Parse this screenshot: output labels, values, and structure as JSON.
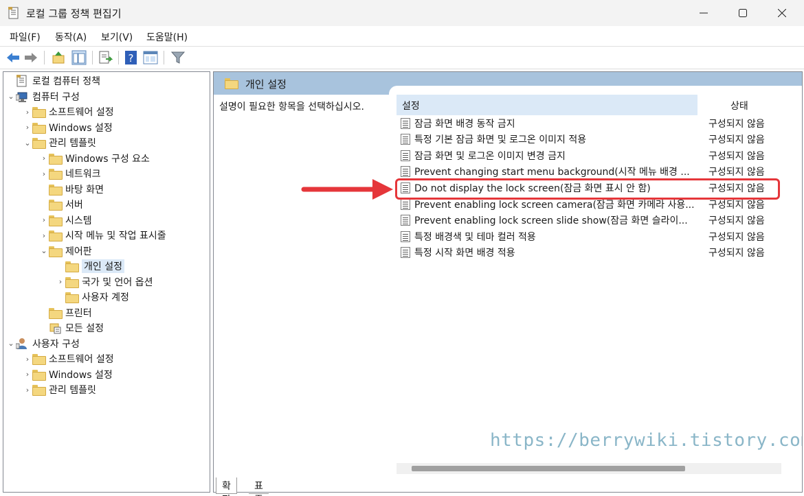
{
  "window": {
    "title": "로컬 그룹 정책 편집기",
    "minimize": "—",
    "maximize": "☐",
    "close": "✕"
  },
  "menu": [
    "파일(F)",
    "동작(A)",
    "보기(V)",
    "도움말(H)"
  ],
  "toolbar": {
    "icons": [
      "back-icon",
      "forward-icon",
      "up-folder-icon",
      "show-hide-tree-icon",
      "export-list-icon",
      "help-icon",
      "properties-icon",
      "filter-icon"
    ]
  },
  "tree": [
    {
      "label": "로컬 컴퓨터 정책",
      "level": 0,
      "chevron": "",
      "icon": "policy-doc-icon"
    },
    {
      "label": "컴퓨터 구성",
      "level": 0,
      "chevron": "⌄",
      "icon": "computer-icon"
    },
    {
      "label": "소프트웨어 설정",
      "level": 1,
      "chevron": "›",
      "icon": "folder-icon"
    },
    {
      "label": "Windows 설정",
      "level": 1,
      "chevron": "›",
      "icon": "folder-icon"
    },
    {
      "label": "관리 템플릿",
      "level": 1,
      "chevron": "⌄",
      "icon": "folder-icon"
    },
    {
      "label": "Windows 구성 요소",
      "level": 2,
      "chevron": "›",
      "icon": "folder-icon"
    },
    {
      "label": "네트워크",
      "level": 2,
      "chevron": "›",
      "icon": "folder-icon"
    },
    {
      "label": "바탕 화면",
      "level": 2,
      "chevron": "",
      "icon": "folder-icon"
    },
    {
      "label": "서버",
      "level": 2,
      "chevron": "",
      "icon": "folder-icon"
    },
    {
      "label": "시스템",
      "level": 2,
      "chevron": "›",
      "icon": "folder-icon"
    },
    {
      "label": "시작 메뉴 및 작업 표시줄",
      "level": 2,
      "chevron": "›",
      "icon": "folder-icon"
    },
    {
      "label": "제어판",
      "level": 2,
      "chevron": "⌄",
      "icon": "folder-icon"
    },
    {
      "label": "개인 설정",
      "level": 3,
      "chevron": "",
      "icon": "folder-open-icon",
      "selected": true
    },
    {
      "label": "국가 및 언어 옵션",
      "level": 3,
      "chevron": "›",
      "icon": "folder-icon"
    },
    {
      "label": "사용자 계정",
      "level": 3,
      "chevron": "",
      "icon": "folder-icon"
    },
    {
      "label": "프린터",
      "level": 2,
      "chevron": "",
      "icon": "folder-icon"
    },
    {
      "label": "모든 설정",
      "level": 2,
      "chevron": "",
      "icon": "all-settings-icon"
    },
    {
      "label": "사용자 구성",
      "level": 0,
      "chevron": "⌄",
      "icon": "user-icon"
    },
    {
      "label": "소프트웨어 설정",
      "level": 1,
      "chevron": "›",
      "icon": "folder-icon"
    },
    {
      "label": "Windows 설정",
      "level": 1,
      "chevron": "›",
      "icon": "folder-icon"
    },
    {
      "label": "관리 템플릿",
      "level": 1,
      "chevron": "›",
      "icon": "folder-icon"
    }
  ],
  "right": {
    "header": "개인 설정",
    "description": "설명이 필요한 항목을 선택하십시오.",
    "col_setting": "설정",
    "col_state": "상태",
    "rows": [
      {
        "name": "잠금 화면 배경 동작 금지",
        "state": "구성되지 않음"
      },
      {
        "name": "특정 기본 잠금 화면 및 로그온 이미지 적용",
        "state": "구성되지 않음"
      },
      {
        "name": "잠금 화면 및 로그온 이미지 변경 금지",
        "state": "구성되지 않음"
      },
      {
        "name": "Prevent changing start menu background(시작 메뉴 배경 ...",
        "state": "구성되지 않음"
      },
      {
        "name": "Do not display the lock screen(잠금 화면 표시 안 함)",
        "state": "구성되지 않음",
        "highlighted": true
      },
      {
        "name": "Prevent enabling lock screen camera(잠금 화면 카메라 사용...",
        "state": "구성되지 않음"
      },
      {
        "name": "Prevent enabling lock screen slide show(잠금 화면 슬라이...",
        "state": "구성되지 않음"
      },
      {
        "name": "특정 배경색 및 테마 컬러 적용",
        "state": "구성되지 않음"
      },
      {
        "name": "특정 시작 화면 배경 적용",
        "state": "구성되지 않음"
      }
    ]
  },
  "tabs": [
    "확장",
    "표준"
  ],
  "watermark": "https://berrywiki.tistory.com",
  "colors": {
    "highlight": "#e5363a",
    "header": "#a8c3dd",
    "selection": "#dbe9f7"
  }
}
